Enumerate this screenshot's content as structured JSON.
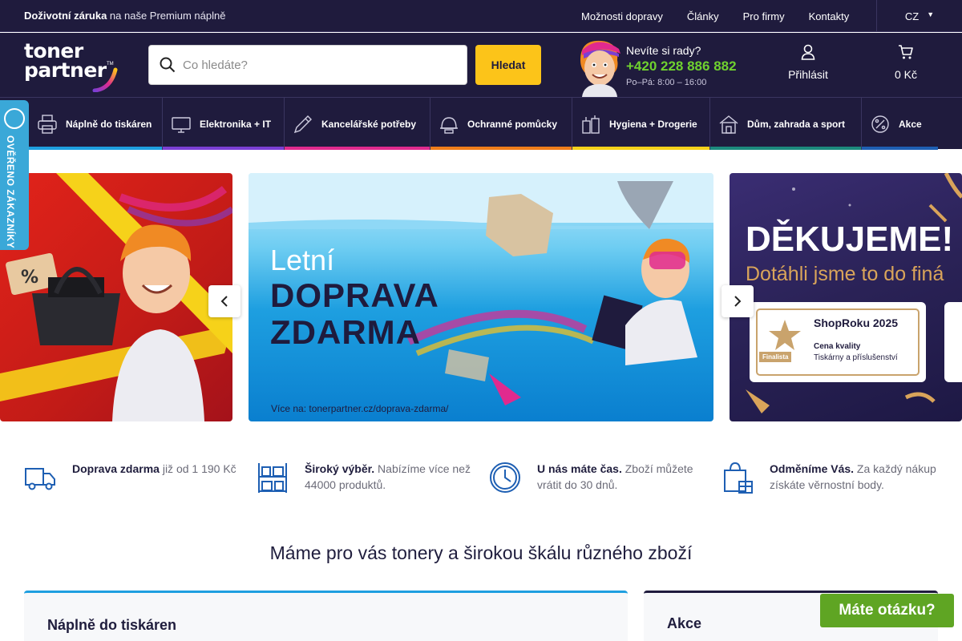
{
  "topbar": {
    "promo_bold": "Doživotní záruka",
    "promo_rest": " na naše Premium náplně",
    "links": [
      "Možnosti dopravy",
      "Články",
      "Pro firmy",
      "Kontakty"
    ],
    "language": "CZ"
  },
  "header": {
    "logo_line1": "toner",
    "logo_line2": "partner",
    "logo_tm": "TM",
    "search_placeholder": "Co hledáte?",
    "search_button": "Hledat",
    "help_question": "Nevíte si rady?",
    "help_phone": "+420 228 886 882",
    "help_hours": "Po–Pá: 8:00 – 16:00",
    "account_label": "Přihlásit",
    "cart_label": "0 Kč"
  },
  "categories": [
    {
      "label": "Náplně do tiskáren",
      "icon": "printer-icon",
      "color": "#1e9fe0"
    },
    {
      "label": "Elektronika + IT",
      "icon": "monitor-icon",
      "color": "#7b3fd4"
    },
    {
      "label": "Kancelářské potřeby",
      "icon": "pen-icon",
      "color": "#e02a8e"
    },
    {
      "label": "Ochranné pomůcky",
      "icon": "helmet-icon",
      "color": "#f07d1a"
    },
    {
      "label": "Hygiena + Drogerie",
      "icon": "drogerie-icon",
      "color": "#f6d21a"
    },
    {
      "label": "Dům, zahrada a sport",
      "icon": "house-icon",
      "color": "#1c8a7d"
    },
    {
      "label": "Akce",
      "icon": "percent-badge-icon",
      "color": "#1e5fb3"
    }
  ],
  "sidetab": {
    "label": "OVĚŘENO ZÁKAZNÍKY"
  },
  "banners": {
    "middle_line1": "Letní",
    "middle_line2": "DOPRAVA",
    "middle_line3": "ZDARMA",
    "middle_note": "Více na: tonerpartner.cz/doprava-zdarma/",
    "right_title": "DĚKUJEME!",
    "right_subtitle": "Dotáhli jsme to do finá",
    "award_name": "ShopRoku 2025",
    "award_category": "Cena kvality",
    "award_segment": "Tiskárny a příslušenství",
    "award_badge": "Finalista"
  },
  "usps": [
    {
      "bold": "Doprava zdarma",
      "rest": " již od 1 190 Kč",
      "icon": "truck-icon"
    },
    {
      "bold": "Široký výběr.",
      "rest": " Nabízíme více než 44000 produktů.",
      "icon": "shelf-icon"
    },
    {
      "bold": "U nás máte čas.",
      "rest": " Zboží můžete vrátit do 30 dnů.",
      "icon": "clock-icon"
    },
    {
      "bold": "Odměníme Vás.",
      "rest": " Za každý nákup získáte věrnostní body.",
      "icon": "gift-bag-icon"
    }
  ],
  "headline": "Máme pro vás tonery a širokou škálu různého zboží",
  "cards": {
    "left_title": "Náplně do tiskáren",
    "right_title": "Akce"
  },
  "chat_label": "Máte otázku?",
  "colors": {
    "navy": "#1f1b3d",
    "yellow": "#fcc419",
    "green": "#6fd12f",
    "chat": "#5fa523",
    "sidetab": "#3aa8d8"
  }
}
